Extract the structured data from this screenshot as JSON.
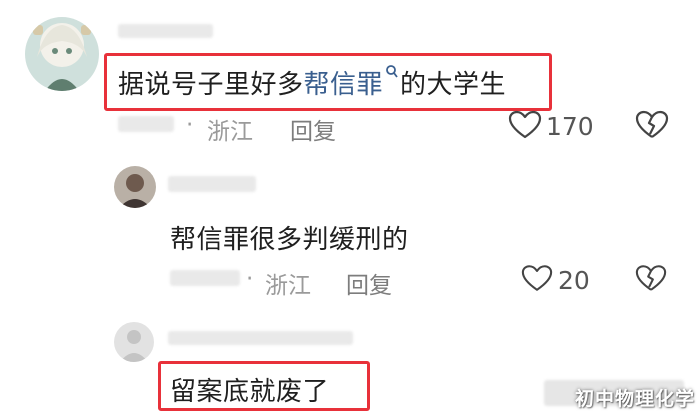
{
  "comments": [
    {
      "text_before": "据说号子里好多",
      "link_text": "帮信罪",
      "text_after": "的大学生",
      "location": "浙江",
      "reply_label": "回复",
      "likes": "170"
    },
    {
      "text": "帮信罪很多判缓刑的",
      "location": "浙江",
      "reply_label": "回复",
      "likes": "20"
    },
    {
      "text": "留案底就废了"
    }
  ],
  "dot_separator": "·",
  "watermark": "初中物理化学",
  "colors": {
    "highlight_border": "#e8313a",
    "link": "#3a5f8f",
    "meta_text": "#9a9a9a"
  }
}
